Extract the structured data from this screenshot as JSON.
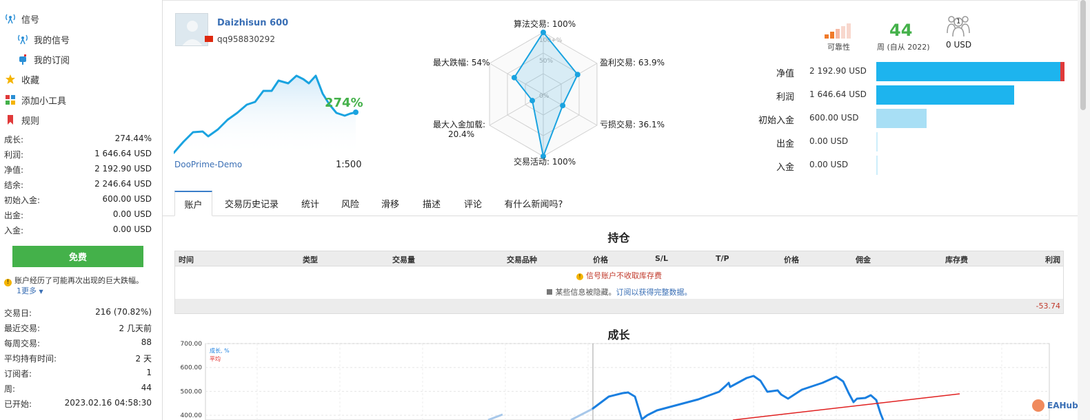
{
  "sidebar": {
    "nav": [
      {
        "label": "信号",
        "icon": "signal-tower-icon"
      },
      {
        "label": "我的信号",
        "icon": "signal-tower-icon"
      },
      {
        "label": "我的订阅",
        "icon": "mailbox-icon"
      },
      {
        "label": "收藏",
        "icon": "star-icon"
      },
      {
        "label": "添加小工具",
        "icon": "widget-icon"
      },
      {
        "label": "规则",
        "icon": "bookmark-icon"
      }
    ],
    "stats": [
      {
        "label": "成长:",
        "value": "274.44%"
      },
      {
        "label": "利润:",
        "value": "1 646.64 USD"
      },
      {
        "label": "净值:",
        "value": "2 192.90 USD"
      },
      {
        "label": "结余:",
        "value": "2 246.64 USD"
      },
      {
        "label": "初始入金:",
        "value": "600.00 USD"
      },
      {
        "label": "出金:",
        "value": "0.00 USD"
      },
      {
        "label": "入金:",
        "value": "0.00 USD"
      }
    ],
    "free_button": "免费",
    "warning": "账户经历了可能再次出现的巨大跌幅。",
    "more": "1更多",
    "stats2": [
      {
        "label": "交易日:",
        "value": "216 (70.82%)"
      },
      {
        "label": "最近交易:",
        "value": "2 几天前"
      },
      {
        "label": "每周交易:",
        "value": "88"
      },
      {
        "label": "平均持有时间:",
        "value": "2 天"
      },
      {
        "label": "订阅者:",
        "value": "1"
      },
      {
        "label": "周:",
        "value": "44"
      },
      {
        "label": "已开始:",
        "value": "2023.02.16 04:58:30"
      }
    ]
  },
  "account": {
    "name": "Daizhisun 600",
    "user": "qq958830292",
    "broker": "DooPrime-Demo",
    "leverage": "1:500",
    "growth": "274%"
  },
  "radar": {
    "labels": {
      "algo": "算法交易: 100%",
      "profit": "盈利交易: 63.9%",
      "loss": "亏损交易: 36.1%",
      "activity": "交易活动: 100%",
      "load": "最大入金加载:",
      "load_value": "20.4%",
      "drawdown": "最大跌幅: 54%"
    },
    "rings": [
      "100+%",
      "50%",
      "0%"
    ],
    "values": {
      "algo": 100,
      "profit": 63.9,
      "loss": 36.1,
      "activity": 100,
      "load": 20.4,
      "drawdown": 54
    },
    "color": "#1aa3e0"
  },
  "summary": {
    "reliability_label": "可靠性",
    "weeks": "44",
    "weeks_label": "周 (自从 2022)",
    "subscribers_value": "0 USD",
    "subscribers_count": "1",
    "bars": [
      {
        "label": "净值",
        "value": "2 192.90 USD"
      },
      {
        "label": "利润",
        "value": "1 646.64 USD"
      },
      {
        "label": "初始入金",
        "value": "600.00 USD"
      },
      {
        "label": "出金",
        "value": "0.00 USD"
      },
      {
        "label": "入金",
        "value": "0.00 USD"
      }
    ]
  },
  "tabs": [
    "账户",
    "交易历史记录",
    "统计",
    "风险",
    "滑移",
    "描述",
    "评论",
    "有什么新闻吗?"
  ],
  "positions": {
    "title": "持仓",
    "columns": [
      "时间",
      "类型",
      "交易量",
      "交易品种",
      "价格",
      "S/L",
      "T/P",
      "价格",
      "佣金",
      "库存费",
      "利润"
    ],
    "notice": "信号账户不收取库存费",
    "hidden_prefix": "某些信息被隐藏。",
    "hidden_link": "订阅以获得完整数据。",
    "total": "-53.74"
  },
  "growth": {
    "title": "成长",
    "legend_growth": "成长, %",
    "legend_avg": "平均",
    "yticks": [
      "700.00",
      "600.00",
      "500.00",
      "400.00"
    ]
  },
  "chart_data": {
    "type": "line",
    "title": "成长",
    "ylim": [
      380,
      700
    ],
    "yticks": [
      700,
      600,
      500,
      400
    ],
    "series": [
      {
        "name": "成长, %",
        "color": "#1a7fe0"
      },
      {
        "name": "平均",
        "color": "#e02020"
      }
    ]
  },
  "watermark": "EAHub"
}
